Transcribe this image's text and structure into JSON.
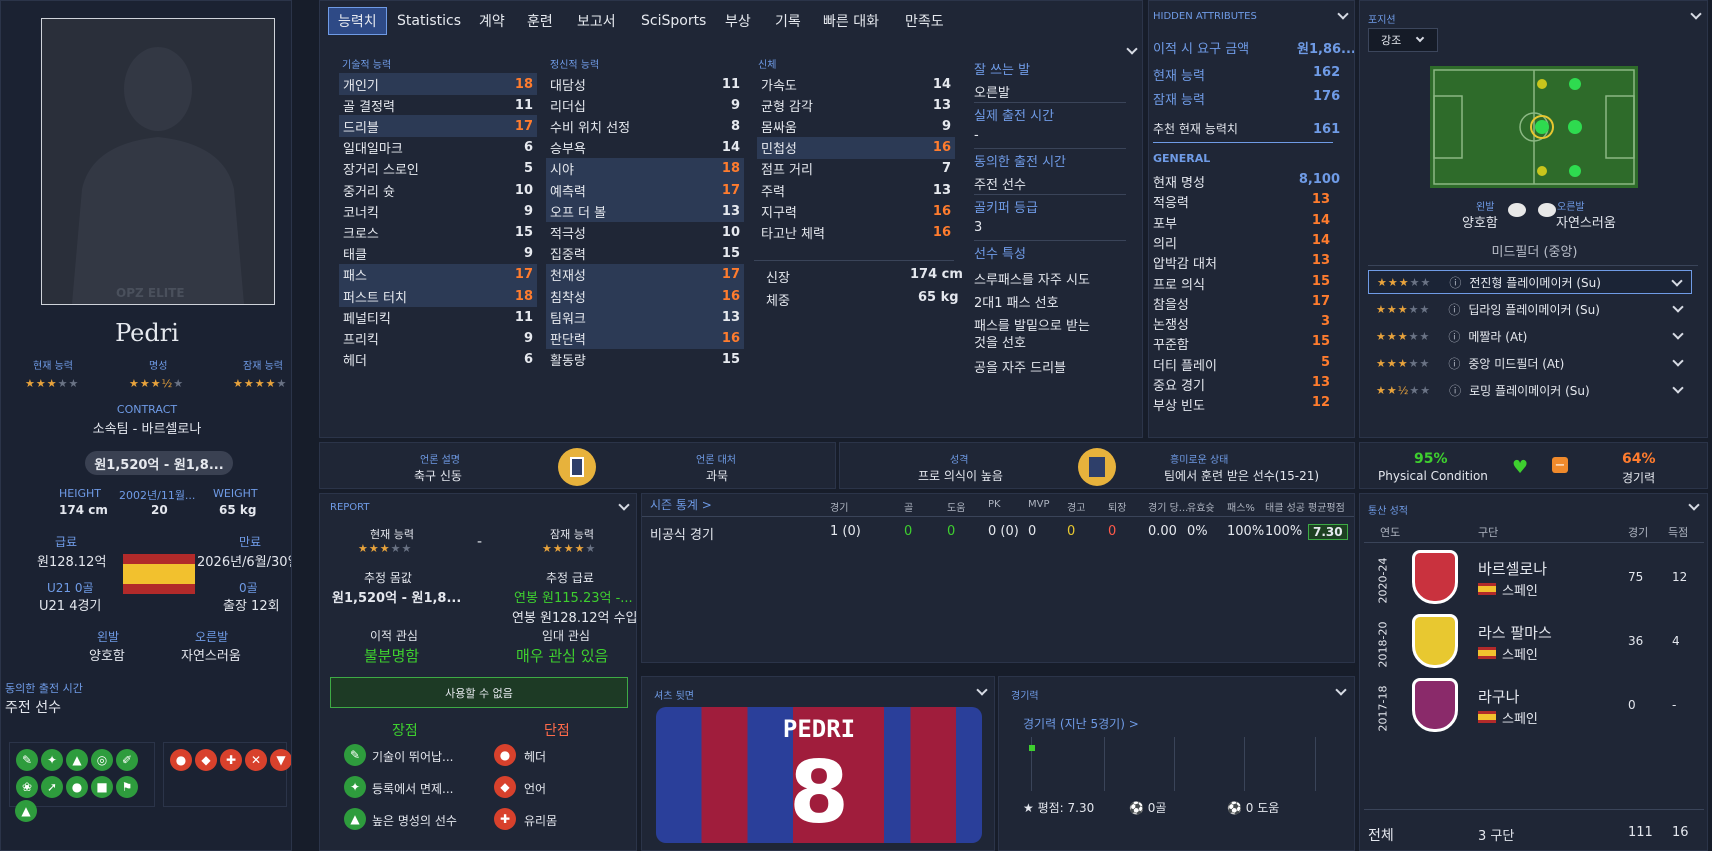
{
  "profile": {
    "name": "Pedri",
    "watermark": "OPZ ELITE",
    "labels": {
      "ca": "현재 능력",
      "rep": "명성",
      "pa": "잠재 능력",
      "contract": "CONTRACT",
      "height": "HEIGHT",
      "dob": "2002년/11월...",
      "weight": "WEIGHT",
      "wage": "급료",
      "expiry": "만료",
      "u21": "U21 0골",
      "zero": "0골",
      "left": "왼발",
      "right": "오른발",
      "agreed": "동의한 출전 시간"
    },
    "club": "소속팀 - 바르셀로나",
    "value": "원1,520억 - 원1,8...",
    "height": "174 cm",
    "age": "20",
    "weight": "65 kg",
    "wage": "원128.12억",
    "expiry": "2026년/6월/30일",
    "u21apps": "U21 4경기",
    "apps": "출장 12회",
    "left_foot": "양호함",
    "right_foot": "자연스러움",
    "playing_time": "주전 선수",
    "stars": {
      "ca": "★★★",
      "ca_e": "★★",
      "rep": "★★★½",
      "rep_e": "★",
      "pa": "★★★★",
      "pa_e": "★"
    }
  },
  "tabs": [
    "능력치",
    "Statistics",
    "계약",
    "훈련",
    "보고서",
    "SciSports",
    "부상",
    "기록",
    "빠른 대화",
    "만족도"
  ],
  "attributes": {
    "tech_title": "기술적 능력",
    "mental_title": "정신적 능력",
    "phys_title": "신체",
    "technical": [
      {
        "n": "개인기",
        "v": "18"
      },
      {
        "n": "골 결정력",
        "v": "11"
      },
      {
        "n": "드리블",
        "v": "17"
      },
      {
        "n": "일대일마크",
        "v": "6"
      },
      {
        "n": "장거리 스로인",
        "v": "5"
      },
      {
        "n": "중거리 슛",
        "v": "10"
      },
      {
        "n": "코너킥",
        "v": "9"
      },
      {
        "n": "크로스",
        "v": "15"
      },
      {
        "n": "태클",
        "v": "9"
      },
      {
        "n": "패스",
        "v": "17"
      },
      {
        "n": "퍼스트 터치",
        "v": "18"
      },
      {
        "n": "페널티킥",
        "v": "11"
      },
      {
        "n": "프리킥",
        "v": "9"
      },
      {
        "n": "헤더",
        "v": "6"
      }
    ],
    "mental": [
      {
        "n": "대담성",
        "v": "11"
      },
      {
        "n": "리더십",
        "v": "9"
      },
      {
        "n": "수비 위치 선정",
        "v": "8"
      },
      {
        "n": "승부욕",
        "v": "14"
      },
      {
        "n": "시야",
        "v": "18"
      },
      {
        "n": "예측력",
        "v": "17"
      },
      {
        "n": "오프 더 볼",
        "v": "13"
      },
      {
        "n": "적극성",
        "v": "10"
      },
      {
        "n": "집중력",
        "v": "15"
      },
      {
        "n": "천재성",
        "v": "17"
      },
      {
        "n": "침착성",
        "v": "16"
      },
      {
        "n": "팀워크",
        "v": "13"
      },
      {
        "n": "판단력",
        "v": "16"
      },
      {
        "n": "활동량",
        "v": "15"
      }
    ],
    "physical": [
      {
        "n": "가속도",
        "v": "14"
      },
      {
        "n": "균형 감각",
        "v": "13"
      },
      {
        "n": "몸싸움",
        "v": "9"
      },
      {
        "n": "민첩성",
        "v": "16"
      },
      {
        "n": "점프 거리",
        "v": "7"
      },
      {
        "n": "주력",
        "v": "13"
      },
      {
        "n": "지구력",
        "v": "16"
      },
      {
        "n": "타고난 체력",
        "v": "16"
      }
    ],
    "height_label": "신장",
    "height": "174 cm",
    "weight_label": "체중",
    "weight": "65 kg"
  },
  "info": {
    "foot_t": "잘 쓰는 발",
    "foot": "오른발",
    "time_t": "실제 출전 시간",
    "time": "-",
    "agreed_t": "동의한 출전 시간",
    "agreed": "주전 선수",
    "gk_t": "골키퍼 등급",
    "gk": "3",
    "traits_t": "선수 특성",
    "traits": [
      "스루패스를 자주 시도",
      "2대1 패스 선호",
      "패스를 발밑으로 받는",
      "것을 선호",
      "공을 자주 드리블"
    ]
  },
  "hidden": {
    "title": "HIDDEN ATTRIBUTES",
    "fee_l": "이적 시 요구 금액",
    "fee": "원1,86...",
    "ca_l": "현재 능력",
    "ca": "162",
    "pa_l": "잠재 능력",
    "pa": "176",
    "rec_l": "추천 현재 능력치",
    "rec": "161",
    "general": "GENERAL",
    "rows": [
      {
        "n": "현재 명성",
        "v": "8,100"
      },
      {
        "n": "적응력",
        "v": "13"
      },
      {
        "n": "포부",
        "v": "14"
      },
      {
        "n": "의리",
        "v": "14"
      },
      {
        "n": "압박감 대처",
        "v": "13"
      },
      {
        "n": "프로 의식",
        "v": "15"
      },
      {
        "n": "참을성",
        "v": "17"
      },
      {
        "n": "논쟁성",
        "v": "3"
      },
      {
        "n": "꾸준함",
        "v": "15"
      },
      {
        "n": "더티 플레이",
        "v": "5"
      },
      {
        "n": "중요 경기",
        "v": "13"
      },
      {
        "n": "부상 빈도",
        "v": "12"
      }
    ]
  },
  "position": {
    "title": "포지션",
    "filter": "강조",
    "left_l": "왼발",
    "left": "양호함",
    "right_l": "오른발",
    "right": "자연스러움",
    "role": "미드필더 (중앙)",
    "roles": [
      {
        "s": "★★★",
        "e": "★★",
        "n": "전진형 플레이메이커 (Su)"
      },
      {
        "s": "★★★",
        "e": "★★",
        "n": "딥라잉 플레이메이커 (Su)"
      },
      {
        "s": "★★★",
        "e": "★★",
        "n": "메짤라 (At)"
      },
      {
        "s": "★★★",
        "e": "★★",
        "n": "중앙 미드필더 (At)"
      },
      {
        "s": "★★½",
        "e": "★★",
        "n": "로밍 플레이메이커 (Su)"
      }
    ]
  },
  "media": {
    "desc_l": "언론 설명",
    "desc": "축구 신동",
    "handle_l": "언론 대처",
    "handle": "과묵",
    "pers_l": "성격",
    "pers": "프로 의식이 높음",
    "state_l": "흥미로운 상태",
    "state": "팀에서 훈련 받은 선수(15-21)"
  },
  "condition": {
    "phys": "95%",
    "phys_l": "Physical Condition",
    "sharp": "64%",
    "sharp_l": "경기력",
    "heart": "heart-icon"
  },
  "report": {
    "title": "REPORT",
    "ca_l": "현재 능력",
    "pa_l": "잠재 능력",
    "dash": "-",
    "val_l": "추정 몸값",
    "val": "원1,520억 - 원1,8...",
    "wage_l": "추정 급료",
    "wage": "연봉 원115.23억 -...",
    "wage2": "연봉 원128.12억 수입",
    "transfer_l": "이적 관심",
    "transfer": "불분명함",
    "loan_l": "임대 관심",
    "loan": "매우 관심 있음",
    "unavailable": "사용할 수 없음",
    "pros": "장점",
    "cons": "단점",
    "pros_list": [
      "기술이 뛰어납...",
      "등록에서 면제...",
      "높은 명성의 선수"
    ],
    "cons_list": [
      "헤더",
      "언어",
      "유리몸"
    ]
  },
  "season": {
    "title": "시즌 통계 >",
    "headers": [
      "경기",
      "골",
      "도움",
      "PK",
      "MVP",
      "경고",
      "퇴장",
      "경기 당...",
      "유효슛",
      "패스%",
      "태클 성공",
      "평균평점"
    ],
    "row_l": "비공식 경기",
    "row": [
      "1 (0)",
      "0",
      "0",
      "0 (0)",
      "0",
      "0",
      "0",
      "0.00",
      "0%",
      "100%",
      "100%",
      "7.30"
    ]
  },
  "shirt": {
    "title": "셔츠 뒷면",
    "name": "PEDRI",
    "number": "8"
  },
  "form": {
    "title": "경기력",
    "sub": "경기력 (지난 5경기) >",
    "rating": "평점: 7.30",
    "goals": "0골",
    "assists": "0 도움"
  },
  "career": {
    "title": "통산 성적",
    "h_year": "연도",
    "h_club": "구단",
    "h_apps": "경기",
    "h_goals": "득점",
    "rows": [
      {
        "y": "2020-24",
        "club": "바르셀로나",
        "nat": "스페인",
        "apps": "75",
        "goals": "12"
      },
      {
        "y": "2018-20",
        "club": "라스 팔마스",
        "nat": "스페인",
        "apps": "36",
        "goals": "4"
      },
      {
        "y": "2017-18",
        "club": "라구나",
        "nat": "스페인",
        "apps": "0",
        "goals": "-"
      }
    ],
    "total_l": "전체",
    "total_clubs": "3 구단",
    "total_apps": "111",
    "total_goals": "16"
  },
  "colors": {
    "bg": "#171d2a",
    "panel": "#1f2636",
    "accent": "#6f9be6",
    "orange": "#ff7c2e",
    "green": "#3ecf2f"
  }
}
